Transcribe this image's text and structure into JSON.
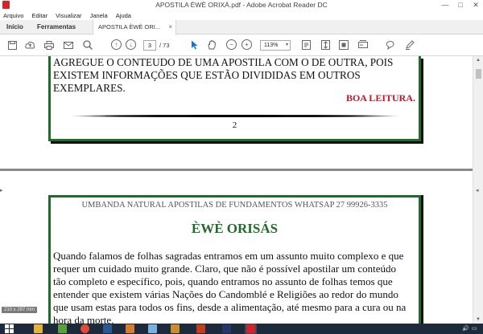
{
  "window": {
    "title": "APOSTILA ÈWÈ ORIXÁ.pdf - Adobe Acrobat Reader DC",
    "controls": [
      "—",
      "□",
      "✕"
    ]
  },
  "menu": [
    "Arquivo",
    "Editar",
    "Visualizar",
    "Janela",
    "Ajuda"
  ],
  "tabs": {
    "home": "Início",
    "tools": "Ferramentas",
    "document": "APOSTILA ÈWÈ ORI...",
    "close": "×"
  },
  "toolbar": {
    "page_current": "3",
    "page_total": "/ 73",
    "zoom": "113%",
    "icons": [
      "save-icon",
      "upload-icon",
      "print-icon",
      "email-icon",
      "search-icon",
      "prev-page-icon",
      "next-page-icon",
      "select-cursor-icon",
      "hand-icon",
      "zoom-out-icon",
      "zoom-in-icon",
      "fit-page-icon",
      "scroll-mode-icon",
      "full-screen-icon",
      "form-icon",
      "comment-icon",
      "pen-icon"
    ]
  },
  "page1": {
    "lines": [
      "AGREGUE O CONTEUDO DE UMA APOSTILA COM O DE OUTRA, POIS",
      "EXISTEM INFORMAÇÕES QUE ESTÃO DIVIDIDAS EM OUTROS",
      "EXEMPLARES."
    ],
    "signoff": "BOA LEITURA.",
    "page_number": "2"
  },
  "page2": {
    "header": "UMBANDA NATURAL APOSTILAS DE FUNDAMENTOS WHATSAP 27 99926-3335",
    "title": "ÈWÈ ORISÁS",
    "lines": [
      " Quando falamos de folhas sagradas entramos em um assunto muito complexo e que",
      "requer um cuidado muito grande. Claro, que não é possível apostilar um conteúdo",
      "tão completo e específico, pois, quando entramos no assunto de folhas temos que",
      "entender que existem várias Nações do Candomblé e Religiões ao redor do mundo",
      "que usam estas para todos os fins, desde a alimentação, até mesmo para a cura ou na",
      "hora da morte."
    ]
  },
  "page_size_chip": "210 x 297 mm",
  "colors": {
    "page_border": "#1f6b2a",
    "title_green": "#1f6b2a",
    "signoff_red": "#c0182a",
    "taskbar": "#1c2a3c"
  }
}
